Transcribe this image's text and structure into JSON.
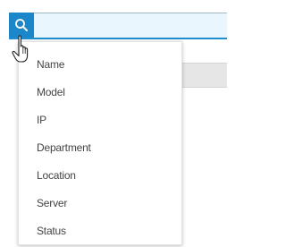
{
  "search": {
    "value": "",
    "placeholder": "",
    "icon": "search-icon"
  },
  "menu": {
    "items": [
      {
        "label": "Name"
      },
      {
        "label": "Model"
      },
      {
        "label": "IP"
      },
      {
        "label": "Department"
      },
      {
        "label": "Location"
      },
      {
        "label": "Server"
      },
      {
        "label": "Status"
      }
    ]
  },
  "colors": {
    "accent": "#1b87c9",
    "search_bg": "#eaf6fd",
    "menu_text": "#444444"
  },
  "cursor": {
    "icon": "hand-pointer-icon"
  }
}
